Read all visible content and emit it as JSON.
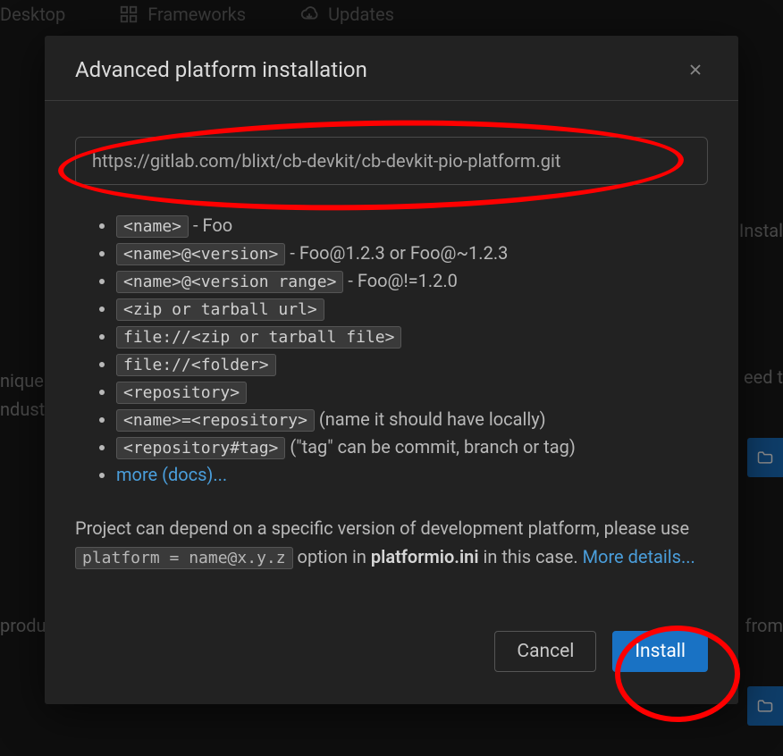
{
  "background": {
    "tabs": [
      {
        "label": "Desktop"
      },
      {
        "label": "Frameworks"
      },
      {
        "label": "Updates"
      }
    ],
    "right_install": "Instal",
    "left_para1": "nique",
    "left_para2": "ndustr",
    "right_para1": "eed t",
    "bottom_left": "produc",
    "bottom_right": "from"
  },
  "modal": {
    "title": "Advanced platform installation",
    "input_value": "https://gitlab.com/blixt/cb-devkit/cb-devkit-pio-platform.git",
    "items": [
      {
        "code": "<name>",
        "suffix": " - Foo"
      },
      {
        "code": "<name>@<version>",
        "suffix": " - Foo@1.2.3 or Foo@~1.2.3"
      },
      {
        "code": "<name>@<version range>",
        "suffix": " - Foo@!=1.2.0"
      },
      {
        "code": "<zip or tarball url>",
        "suffix": ""
      },
      {
        "code": "file://<zip or tarball file>",
        "suffix": ""
      },
      {
        "code": "file://<folder>",
        "suffix": ""
      },
      {
        "code": "<repository>",
        "suffix": ""
      },
      {
        "code": "<name>=<repository>",
        "suffix": " (name it should have locally)"
      },
      {
        "code": "<repository#tag>",
        "suffix": " (\"tag\" can be commit, branch or tag)"
      }
    ],
    "more_docs": "more (docs)...",
    "para_pre": "Project can depend on a specific version of development platform, please use ",
    "para_code": "platform = name@x.y.z",
    "para_mid": " option in ",
    "para_file": "platformio.ini",
    "para_post": " in this case. ",
    "more_details": "More details...",
    "cancel": "Cancel",
    "install": "Install"
  }
}
